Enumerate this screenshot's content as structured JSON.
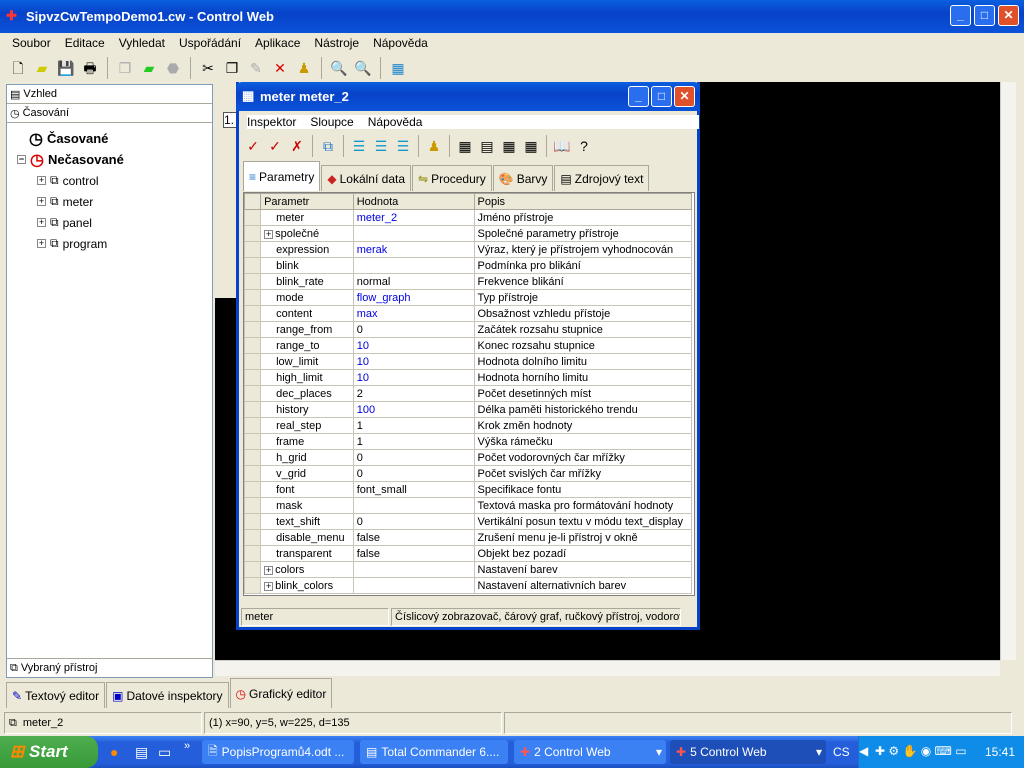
{
  "app": {
    "title": "SipvzCwTempoDemo1.cw - Control Web"
  },
  "menu": [
    "Soubor",
    "Editace",
    "Vyhledat",
    "Uspořádání",
    "Aplikace",
    "Nástroje",
    "Nápověda"
  ],
  "left": {
    "panel1": "Vzhled",
    "panel2": "Časování",
    "tree_timed": "Časované",
    "tree_untimed": "Nečasované",
    "tree_items": [
      "control",
      "meter",
      "panel",
      "program"
    ],
    "bottom": "Vybraný přístroj"
  },
  "editor": {
    "field_value": "1."
  },
  "dialog": {
    "title": "meter meter_2",
    "menu": [
      "Inspektor",
      "Sloupce",
      "Nápověda"
    ],
    "tabs": [
      "Parametry",
      "Lokální data",
      "Procedury",
      "Barvy",
      "Zdrojový text"
    ],
    "columns": [
      "Parametr",
      "Hodnota",
      "Popis"
    ],
    "rows": [
      {
        "p": "meter",
        "v": "meter_2",
        "d": "Jméno přístroje",
        "blue": true
      },
      {
        "p": "společné",
        "v": "",
        "d": "Společné parametry přístroje",
        "expand": true
      },
      {
        "p": "expression",
        "v": "merak",
        "d": "Výraz, který je přístrojem vyhodnocován",
        "blue": true
      },
      {
        "p": "blink",
        "v": "",
        "d": "Podmínka pro blikání"
      },
      {
        "p": "blink_rate",
        "v": "normal",
        "d": "Frekvence blikání"
      },
      {
        "p": "mode",
        "v": "flow_graph",
        "d": "Typ přístroje",
        "blue": true
      },
      {
        "p": "content",
        "v": "max",
        "d": "Obsažnost vzhledu přístoje",
        "blue": true
      },
      {
        "p": "range_from",
        "v": "0",
        "d": "Začátek rozsahu stupnice"
      },
      {
        "p": "range_to",
        "v": "10",
        "d": "Konec rozsahu stupnice",
        "blue": true
      },
      {
        "p": "low_limit",
        "v": "10",
        "d": "Hodnota dolního limitu",
        "blue": true
      },
      {
        "p": "high_limit",
        "v": "10",
        "d": "Hodnota horního limitu",
        "blue": true
      },
      {
        "p": "dec_places",
        "v": "2",
        "d": "Počet desetinných míst"
      },
      {
        "p": "history",
        "v": "100",
        "d": "Délka paměti historického trendu",
        "blue": true
      },
      {
        "p": "real_step",
        "v": "1",
        "d": "Krok změn hodnoty"
      },
      {
        "p": "frame",
        "v": "1",
        "d": "Výška rámečku"
      },
      {
        "p": "h_grid",
        "v": "0",
        "d": "Počet vodorovných čar mřížky"
      },
      {
        "p": "v_grid",
        "v": "0",
        "d": "Počet svislých čar mřížky"
      },
      {
        "p": "font",
        "v": "font_small",
        "d": "Specifikace fontu"
      },
      {
        "p": "mask",
        "v": "",
        "d": "Textová maska pro formátování hodnoty"
      },
      {
        "p": "text_shift",
        "v": "0",
        "d": "Vertikální posun textu v módu text_display"
      },
      {
        "p": "disable_menu",
        "v": "false",
        "d": "Zrušení menu je-li přístroj v okně"
      },
      {
        "p": "transparent",
        "v": "false",
        "d": "Objekt bez pozadí"
      },
      {
        "p": "colors",
        "v": "",
        "d": "Nastavení barev",
        "expand": true
      },
      {
        "p": "blink_colors",
        "v": "",
        "d": "Nastavení alternativních barev",
        "expand": true
      }
    ],
    "status_left": "meter",
    "status_right": "Číslicový zobrazovač, čárový graf, ručkový přístroj, vodorov"
  },
  "bottom_tabs": [
    "Textový editor",
    "Datové inspektory",
    "Grafický editor"
  ],
  "status": {
    "object": "meter_2",
    "coords": "(1) x=90, y=5, w=225, d=135"
  },
  "taskbar": {
    "start": "Start",
    "items": [
      "PopisProgramů4.odt ...",
      "Total Commander 6....",
      "2 Control Web",
      "5 Control Web"
    ],
    "lang": "CS",
    "clock": "15:41"
  }
}
